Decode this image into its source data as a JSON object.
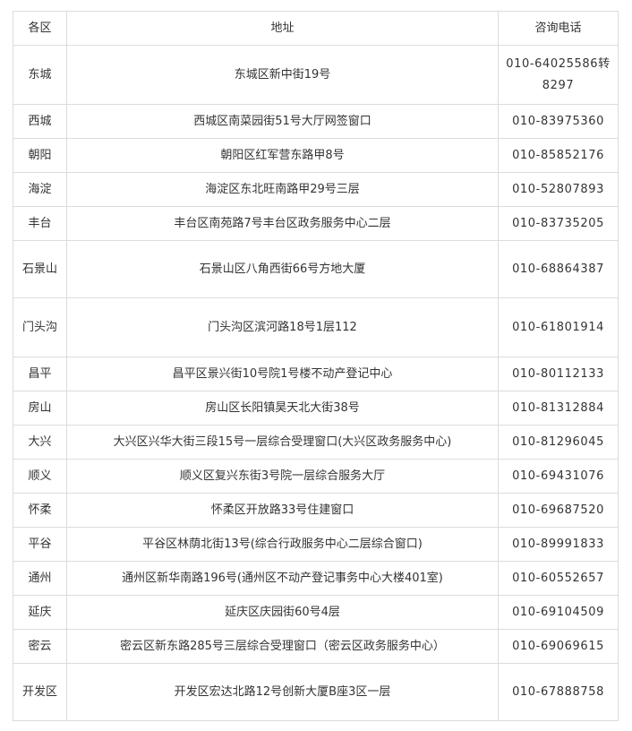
{
  "table": {
    "headers": [
      "各区",
      "地址",
      "咨询电话"
    ],
    "rows": [
      {
        "district": "东城",
        "address": "东城区新中街19号",
        "phone": "010-64025586转8297"
      },
      {
        "district": "西城",
        "address": "西城区南菜园街51号大厅网签窗口",
        "phone": "010-83975360"
      },
      {
        "district": "朝阳",
        "address": "朝阳区红军营东路甲8号",
        "phone": "010-85852176"
      },
      {
        "district": "海淀",
        "address": "海淀区东北旺南路甲29号三层",
        "phone": "010-52807893"
      },
      {
        "district": "丰台",
        "address": "丰台区南苑路7号丰台区政务服务中心二层",
        "phone": "010-83735205"
      },
      {
        "district": "石景山",
        "address": "石景山区八角西街66号方地大厦",
        "phone": "010-68864387"
      },
      {
        "district": "门头沟",
        "address": "门头沟区滨河路18号1层112",
        "phone": "010-61801914"
      },
      {
        "district": "昌平",
        "address": "昌平区景兴街10号院1号楼不动产登记中心",
        "phone": "010-80112133"
      },
      {
        "district": "房山",
        "address": "房山区长阳镇昊天北大街38号",
        "phone": "010-81312884"
      },
      {
        "district": "大兴",
        "address": "大兴区兴华大街三段15号一层综合受理窗口(大兴区政务服务中心)",
        "phone": "010-81296045"
      },
      {
        "district": "顺义",
        "address": "顺义区复兴东街3号院一层综合服务大厅",
        "phone": "010-69431076"
      },
      {
        "district": "怀柔",
        "address": "怀柔区开放路33号住建窗口",
        "phone": "010-69687520"
      },
      {
        "district": "平谷",
        "address": "平谷区林荫北街13号(综合行政服务中心二层综合窗口)",
        "phone": "010-89991833"
      },
      {
        "district": "通州",
        "address": "通州区新华南路196号(通州区不动产登记事务中心大楼401室)",
        "phone": "010-60552657"
      },
      {
        "district": "延庆",
        "address": "延庆区庆园街60号4层",
        "phone": "010-69104509"
      },
      {
        "district": "密云",
        "address": "密云区新东路285号三层综合受理窗口（密云区政务服务中心）",
        "phone": "010-69069615"
      },
      {
        "district": "开发区",
        "address": "开发区宏达北路12号创新大厦B座3区一层",
        "phone": "010-67888758"
      }
    ]
  }
}
